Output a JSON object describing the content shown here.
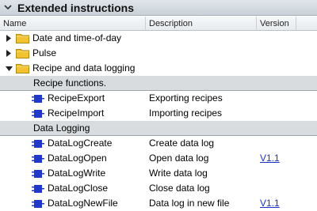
{
  "panel": {
    "title": "Extended instructions"
  },
  "columns": {
    "name": "Name",
    "description": "Description",
    "version": "Version"
  },
  "tree": {
    "folders": [
      {
        "label": "Date and time-of-day",
        "expanded": false
      },
      {
        "label": "Pulse",
        "expanded": false
      },
      {
        "label": "Recipe and data logging",
        "expanded": true
      }
    ],
    "recipe_section": {
      "label": "Recipe functions."
    },
    "recipe_items": [
      {
        "name": "RecipeExport",
        "description": "Exporting recipes",
        "version": ""
      },
      {
        "name": "RecipeImport",
        "description": "Importing recipes",
        "version": ""
      }
    ],
    "datalog_section": {
      "label": "Data Logging"
    },
    "datalog_items": [
      {
        "name": "DataLogCreate",
        "description": "Create data log",
        "version": ""
      },
      {
        "name": "DataLogOpen",
        "description": "Open data log",
        "version": "V1.1"
      },
      {
        "name": "DataLogWrite",
        "description": "Write data log",
        "version": ""
      },
      {
        "name": "DataLogClose",
        "description": "Close data log",
        "version": ""
      },
      {
        "name": "DataLogNewFile",
        "description": "Data log in new file",
        "version": "V1.1"
      }
    ]
  },
  "colors": {
    "link": "#1a33c8",
    "section_bg": "#d8dcdf",
    "folder": "#f2c230",
    "instruction_icon": "#2238c8"
  },
  "icons": {
    "collapse": "chevron-down-icon",
    "folder": "folder-icon",
    "instruction": "instruction-block-icon"
  }
}
